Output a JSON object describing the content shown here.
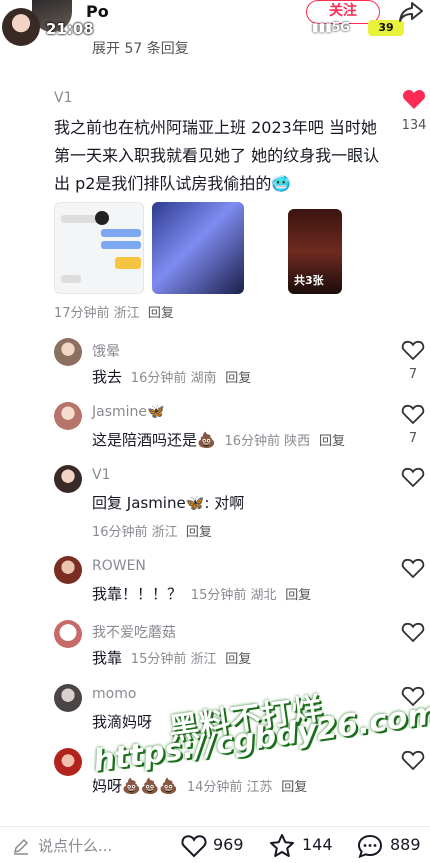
{
  "top": {
    "username": "Po",
    "time": "21:08",
    "follow_label": "关注",
    "signal": "5G",
    "battery": "39",
    "expand_prev": "展开 57 条回复"
  },
  "main_comment": {
    "username": "V1",
    "text": "我之前也在杭州阿瑞亚上班 2023年吧 当时她第一天来入职我就看见她了  她的纹身我一眼认出  p2是我们排队试房我偷拍的🥶",
    "meta": "17分钟前 浙江",
    "reply_label": "回复",
    "likes": "134",
    "media_badge": "共3张"
  },
  "replies": [
    {
      "username": "饿晕",
      "text": "我去",
      "meta": "16分钟前 湖南",
      "reply_label": "回复",
      "likes": "7"
    },
    {
      "username": "Jasmine🦋",
      "text": "这是陪酒吗还是💩",
      "meta": "16分钟前 陕西",
      "reply_label": "回复",
      "likes": "7"
    },
    {
      "username": "V1",
      "text": "回复 Jasmine🦋: 对啊",
      "meta": "16分钟前 浙江",
      "reply_label": "回复",
      "likes": ""
    },
    {
      "username": "ROWEN",
      "text": "我靠！！！？",
      "meta": "15分钟前 湖北",
      "reply_label": "回复",
      "likes": ""
    },
    {
      "username": "我不爱吃蘑菇",
      "text": "我靠",
      "meta": "15分钟前 浙江",
      "reply_label": "回复",
      "likes": ""
    },
    {
      "username": "momo",
      "text": "我滴妈呀",
      "meta": "",
      "reply_label": "",
      "likes": ""
    },
    {
      "username": "",
      "text": "妈呀💩💩💩",
      "meta": "14分钟前 江苏",
      "reply_label": "回复",
      "likes": ""
    }
  ],
  "watermark": {
    "line1": "黑料不打烊",
    "line2": "https://cgbdy26.com"
  },
  "bottom": {
    "placeholder": "说点什么...",
    "likes": "969",
    "favorites": "144",
    "comments": "889"
  },
  "colors": {
    "accent": "#fe2c55",
    "meta": "#8a8b91",
    "text": "#161823"
  }
}
